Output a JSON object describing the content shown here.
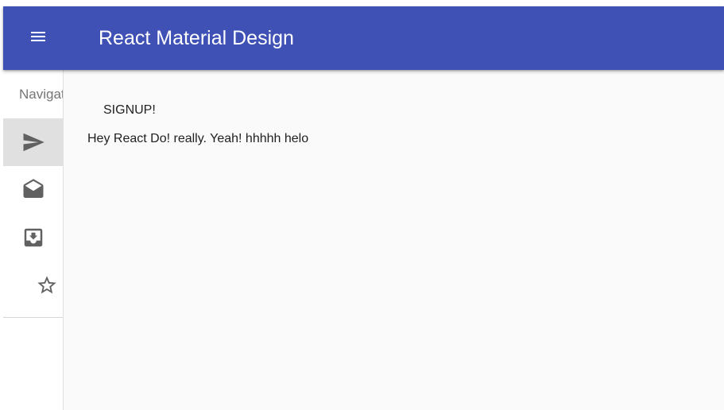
{
  "appbar": {
    "title": "React Material Design",
    "menu_icon": "menu-icon",
    "color": "#3f51b5"
  },
  "drawer": {
    "header": "Navigation",
    "items": [
      {
        "icon": "send-icon",
        "selected": true
      },
      {
        "icon": "drafts-icon",
        "selected": false
      },
      {
        "icon": "move-to-inbox-icon",
        "selected": false
      },
      {
        "icon": "star-border-icon",
        "selected": false
      }
    ]
  },
  "content": {
    "button_label": "SIGNUP!",
    "message": "Hey React Do! really. Yeah! hhhhh helo"
  }
}
